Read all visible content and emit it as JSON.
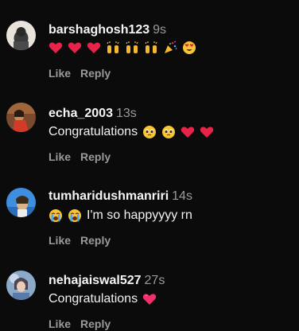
{
  "comments": [
    {
      "username": "barshaghosh123",
      "time": "9s",
      "text_before": "",
      "text_after": "",
      "emojis": [
        "red-heart-icon",
        "red-heart-icon",
        "red-heart-icon",
        "raising-hands-icon",
        "raising-hands-icon",
        "raising-hands-icon",
        "party-popper-icon",
        "heart-eyes-face-icon"
      ],
      "like_label": "Like",
      "reply_label": "Reply"
    },
    {
      "username": "echa_2003",
      "time": "13s",
      "text_before": "Congratulations",
      "text_after": "",
      "emojis": [
        "pleading-face-icon",
        "pleading-face-icon",
        "red-heart-icon",
        "red-heart-icon"
      ],
      "like_label": "Like",
      "reply_label": "Reply"
    },
    {
      "username": "tumharidushmanriri",
      "time": "14s",
      "text_before": "",
      "text_after": "I'm so happyyyy rn",
      "emojis": [
        "crying-face-icon",
        "crying-face-icon"
      ],
      "like_label": "Like",
      "reply_label": "Reply"
    },
    {
      "username": "nehajaiswal527",
      "time": "27s",
      "text_before": "Congratulations",
      "text_after": "",
      "emojis": [
        "pink-heart-icon"
      ],
      "like_label": "Like",
      "reply_label": "Reply"
    }
  ],
  "colors": {
    "background": "#0b0b0b",
    "username": "#f5f5f5",
    "meta": "#9a9a9a",
    "heart": "#e8234a"
  }
}
